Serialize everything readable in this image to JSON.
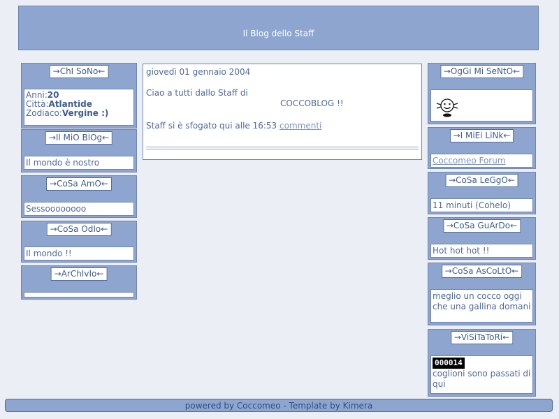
{
  "header": {
    "title": "Il Blog dello Staff"
  },
  "left_widgets": [
    {
      "title": "→ChI SoNo←",
      "fields": [
        {
          "label": "Anni:",
          "value": "20"
        },
        {
          "label": "Città:",
          "value": "Atlantide"
        },
        {
          "label": "Zodiaco:",
          "value": "Vergine :)"
        }
      ]
    },
    {
      "title": "→Il MiO BlOg←",
      "text": "Il mondo è nostro"
    },
    {
      "title": "→CoSa AmO←",
      "text": "Sessoooooooo"
    },
    {
      "title": "→CoSa OdIo←",
      "text": "Il mondo !!"
    },
    {
      "title": "→ArChIvIo←",
      "text": ""
    }
  ],
  "post": {
    "date": "giovedì 01 gennaio 2004",
    "line1": "Ciao a tutti dallo Staff di",
    "line2": "COCCOBLOG  !!",
    "footer_prefix": "Staff si è sfogato qui alle 16:53",
    "comments_link": "commenti"
  },
  "right_widgets": [
    {
      "title": "→OgGi Mi SeNtO←",
      "icon": "smiley-icon"
    },
    {
      "title": "→I MiEi LiNk←",
      "link": "Coccomeo Forum"
    },
    {
      "title": "→CoSa LeGgO←",
      "text": "11 minuti (Cohelo)"
    },
    {
      "title": "→CoSa GuArDo←",
      "text": "Hot hot hot !!"
    },
    {
      "title": "→CoSa AsCoLtO←",
      "text": "meglio un cocco oggi che una gallina domani"
    },
    {
      "title": "→ViSiTaToRi←",
      "counter": "000014",
      "text": "coglioni sono passati di qui"
    }
  ],
  "footer": {
    "text": "powered by Coccomeo - Template by Kimera"
  },
  "colors": {
    "bar": "#8ea6cf",
    "border": "#6f86b0",
    "text": "#4f6a9a",
    "background": "#ebeef4"
  }
}
